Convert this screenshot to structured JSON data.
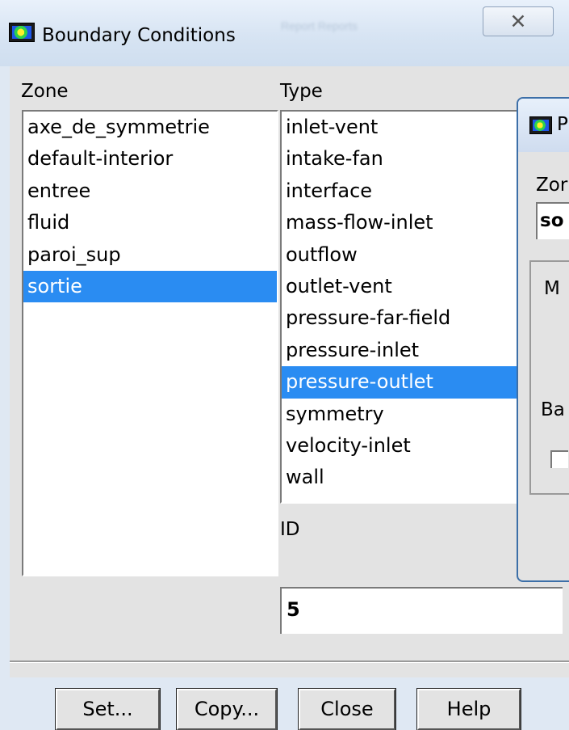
{
  "window": {
    "title": "Boundary Conditions",
    "close_glyph": "✕",
    "background_ghost_text": "Report   Reports"
  },
  "zone": {
    "label": "Zone",
    "items": [
      "axe_de_symmetrie",
      "default-interior",
      "entree",
      "fluid",
      "paroi_sup",
      "sortie"
    ],
    "selected": "sortie"
  },
  "type": {
    "label": "Type",
    "items": [
      "inlet-vent",
      "intake-fan",
      "interface",
      "mass-flow-inlet",
      "outflow",
      "outlet-vent",
      "pressure-far-field",
      "pressure-inlet",
      "pressure-outlet",
      "symmetry",
      "velocity-inlet",
      "wall"
    ],
    "selected": "pressure-outlet"
  },
  "id": {
    "label": "ID",
    "value": "5"
  },
  "buttons": {
    "set": "Set...",
    "copy": "Copy...",
    "close": "Close",
    "help": "Help"
  },
  "overlap_dialog": {
    "title_fragment": "P",
    "zone_label_fragment": "Zor",
    "zone_value_fragment": "so",
    "momentum_fragment": "M",
    "backflow_fragment": "Ba"
  },
  "colors": {
    "selection": "#2a8cf2",
    "panel": "#e3e3e3"
  }
}
